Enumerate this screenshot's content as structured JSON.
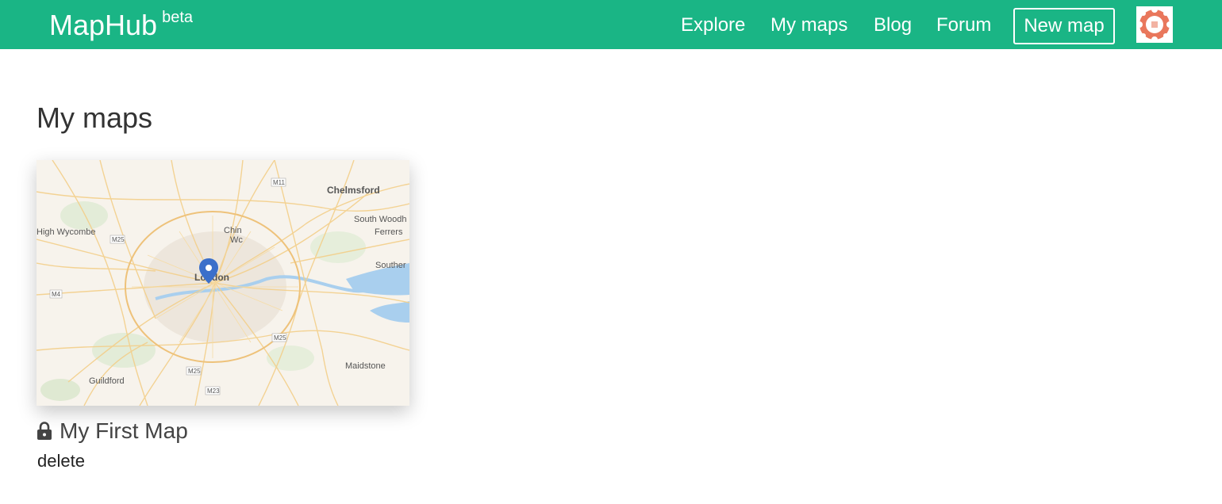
{
  "header": {
    "brand": "MapHub",
    "brand_badge": "beta",
    "nav": [
      "Explore",
      "My maps",
      "Blog",
      "Forum"
    ],
    "new_map_label": "New map",
    "accent_color": "#1ab585"
  },
  "main": {
    "title": "My maps",
    "maps": [
      {
        "title": "My First Map",
        "lock_icon": "lock-icon",
        "delete_label": "delete",
        "thumbnail": {
          "marker_icon": "map-pin-icon",
          "marker_color": "#3b6fca",
          "places": [
            "Chelmsford",
            "South Woodh",
            "Ferrers",
            "High Wycombe",
            "Chin",
            "Wc",
            "London",
            "Souther",
            "Maidstone",
            "Guildford"
          ],
          "roads": [
            "M11",
            "M25",
            "M4",
            "M25",
            "M25",
            "M23"
          ]
        }
      }
    ]
  }
}
